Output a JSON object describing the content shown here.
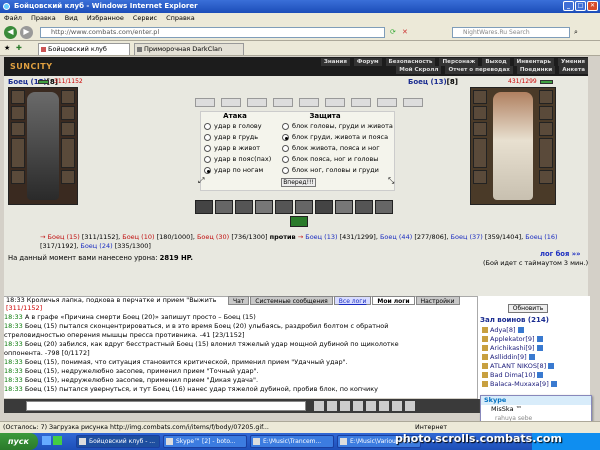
{
  "window": {
    "title": "Бойцовский клуб - Windows Internet Explorer"
  },
  "menu": [
    "Файл",
    "Правка",
    "Вид",
    "Избранное",
    "Сервис",
    "Справка"
  ],
  "address": {
    "url": "http://www.combats.com/enter.pl",
    "search_placeholder": "NightWares.Ru Search"
  },
  "tabs": [
    {
      "label": "Бойцовский клуб"
    },
    {
      "label": "Приморочная DarkClan"
    }
  ],
  "game": {
    "logo": "SUNCITY",
    "top_links": [
      "Знания",
      "Форум",
      "Безопасность",
      "Персонаж",
      "Выход",
      "Инвентарь",
      "Умения",
      "Мой Скролл",
      "Отчет о переводах",
      "Поединки",
      "Анкета"
    ],
    "left_fighter": {
      "name": "Боец (15)",
      "extra": "[8]",
      "hp": "311/1152",
      "hp_fraction": 0.27
    },
    "right_fighter": {
      "name": "Боец (13)",
      "extra": "[8]",
      "hp": "431/1299",
      "hp_fraction": 0.33
    },
    "attack": {
      "title": "Атака",
      "options": [
        "удар в голову",
        "удар в грудь",
        "удар в живот",
        "удар в пояс(пах)",
        "удар по ногам"
      ],
      "selected": 4
    },
    "defense": {
      "title": "Защита",
      "options": [
        "блок головы, груди и живота",
        "блок груди, живота и пояса",
        "блок живота, пояса и ног",
        "блок пояса, ног и головы",
        "блок ног, головы и груди"
      ],
      "selected": 1
    },
    "forward_btn": "Вперед!!!",
    "team_left": [
      {
        "name": "Боец (15)",
        "hp": "[311/1152]"
      },
      {
        "name": "Боец (10)",
        "hp": "[180/1000]"
      },
      {
        "name": "Боец (30)",
        "hp": "[736/1300]"
      }
    ],
    "versus": "против",
    "team_right": [
      {
        "name": "Боец (13)",
        "hp": "[431/1299]"
      },
      {
        "name": "Боец (44)",
        "hp": "[277/806]"
      },
      {
        "name": "Боец (37)",
        "hp": "[359/1404]"
      },
      {
        "name": "Боец (16)",
        "hp": "[317/1192]"
      },
      {
        "name": "Боец (24)",
        "hp": "[335/1300]"
      }
    ],
    "damage_text": "На данный момент вами нанесено урона:",
    "damage_value": "2819 HP.",
    "log_link": "лог боя »»",
    "timeout_text": "(Бой идет с таймаутом 3 мин.)",
    "chat_top_line": "18:33 Кроличья лапка, подкова в перчатке и прием \"Выжить",
    "chat_top_hp": "[311/1152]",
    "chat_tabs": [
      "Чат",
      "Системные сообщения",
      "Все логи",
      "Мои логи",
      "Настройки"
    ],
    "chat_active": 3,
    "log": [
      {
        "time": "18:33",
        "text": "А в графе «Причина смерти Боец (20)» запишут просто – Боец (15)"
      },
      {
        "time": "18:33",
        "text": "Боец (15) пытался сконцентрироваться, и в это время Боец (20) улыбаясь, раздробил болтом с обратной"
      },
      {
        "time": "",
        "text": "стреловидностью оперения мышцы пресса противника. -41 [23/1152]"
      },
      {
        "time": "18:33",
        "text": "Боец (20) забился, как вдруг бесстрастный Боец (15) вломил тяжелый удар мощной дубиной по щиколотке"
      },
      {
        "time": "",
        "text": "оппонента. -798 [0/1172]"
      },
      {
        "time": "18:33",
        "text": "Боец (15), понимая, что ситуация становится критической, применил прием \"Удачный удар\"."
      },
      {
        "time": "18:33",
        "text": "Боец (15), недружелюбно засопев, применил прием \"Точный удар\"."
      },
      {
        "time": "18:33",
        "text": "Боец (15), недружелюбно засопев, применил прием \"Дикая удача\"."
      },
      {
        "time": "18:33",
        "text": "Боец (15) пытался увернуться, и тут Боец (16) нанес удар тяжелой дубиной, пробив блок, по копчику"
      }
    ],
    "right_panel": {
      "refresh": "Обновить",
      "title": "Зал воинов (214)",
      "players": [
        "Adya[8]",
        "Applekator[9]",
        "Arichikashi[9]",
        "Aslliddin[9]",
        "ATLANT NIKOS[8]",
        "Bad Dima[10]",
        "Balaca-Muxaxa[9]"
      ]
    }
  },
  "skype_popup": {
    "title": "Skype",
    "user": "MisSka ™",
    "message": "rahuya sebe"
  },
  "status_text": "(Осталось: 7) Загрузка рисунка http://img.combats.com/i/items/f/body/07205.gif...",
  "status_zone": "Интернет",
  "taskbar": {
    "start": "пуск",
    "items": [
      "Бойцовский клуб - ...",
      "Skype™ [2] - boto...",
      "E:\\Music\\Trancem...",
      "E:\\Music\\Various Ar..."
    ]
  },
  "watermark": "photo.scrolls.combats.com"
}
